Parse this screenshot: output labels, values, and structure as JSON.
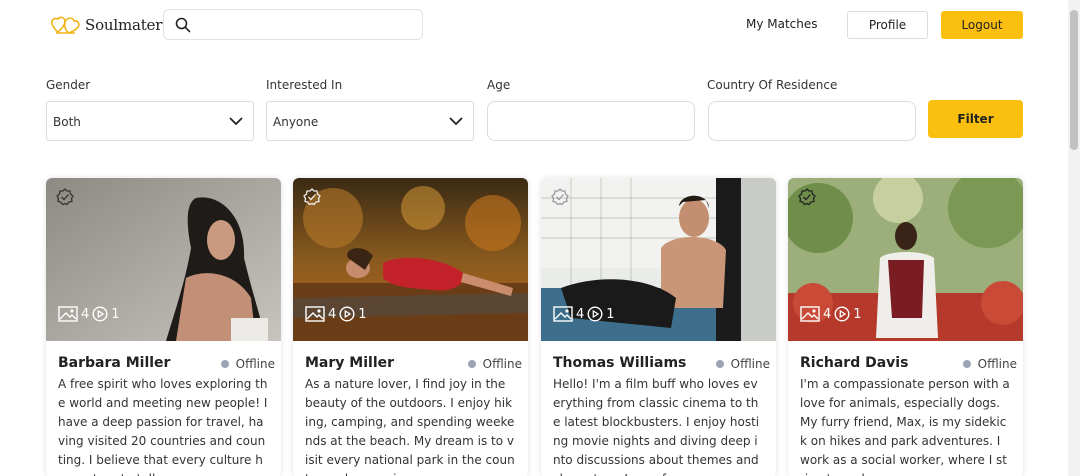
{
  "header": {
    "logo_text": "Soulmater",
    "search": {
      "placeholder": "",
      "value": ""
    },
    "nav_my_matches": "My Matches",
    "profile_label": "Profile",
    "logout_label": "Logout"
  },
  "filters": {
    "gender_label": "Gender",
    "gender_value": "Both",
    "interested_label": "Interested In",
    "interested_value": "Anyone",
    "age_label": "Age",
    "age_value": "",
    "country_label": "Country Of Residence",
    "country_value": "",
    "filter_button": "Filter"
  },
  "colors": {
    "accent": "#fbbf0f",
    "offline_dot": "#9aa4b5"
  },
  "profiles": [
    {
      "name": "Barbara Miller",
      "status": "Offline",
      "photos": "4",
      "videos": "1",
      "bio": "A free spirit who loves exploring the world and meeting new people! I have a deep passion for travel, having visited 20 countries and counting. I believe that every culture has a story to tell,"
    },
    {
      "name": "Mary Miller",
      "status": "Offline",
      "photos": "4",
      "videos": "1",
      "bio": "As a nature lover, I find joy in the beauty of the outdoors. I enjoy hiking, camping, and spending weekends at the beach. My dream is to visit every national park in the country and appreci"
    },
    {
      "name": "Thomas Williams",
      "status": "Offline",
      "photos": "4",
      "videos": "1",
      "bio": "Hello! I'm a film buff who loves everything from classic cinema to the latest blockbusters. I enjoy hosting movie nights and diving deep into discussions about themes and characters. In my f"
    },
    {
      "name": "Richard Davis",
      "status": "Offline",
      "photos": "4",
      "videos": "1",
      "bio": "I'm a compassionate person with a love for animals, especially dogs. My furry friend, Max, is my sidekick on hikes and park adventures. I work as a social worker, where I strive to make a po"
    }
  ]
}
